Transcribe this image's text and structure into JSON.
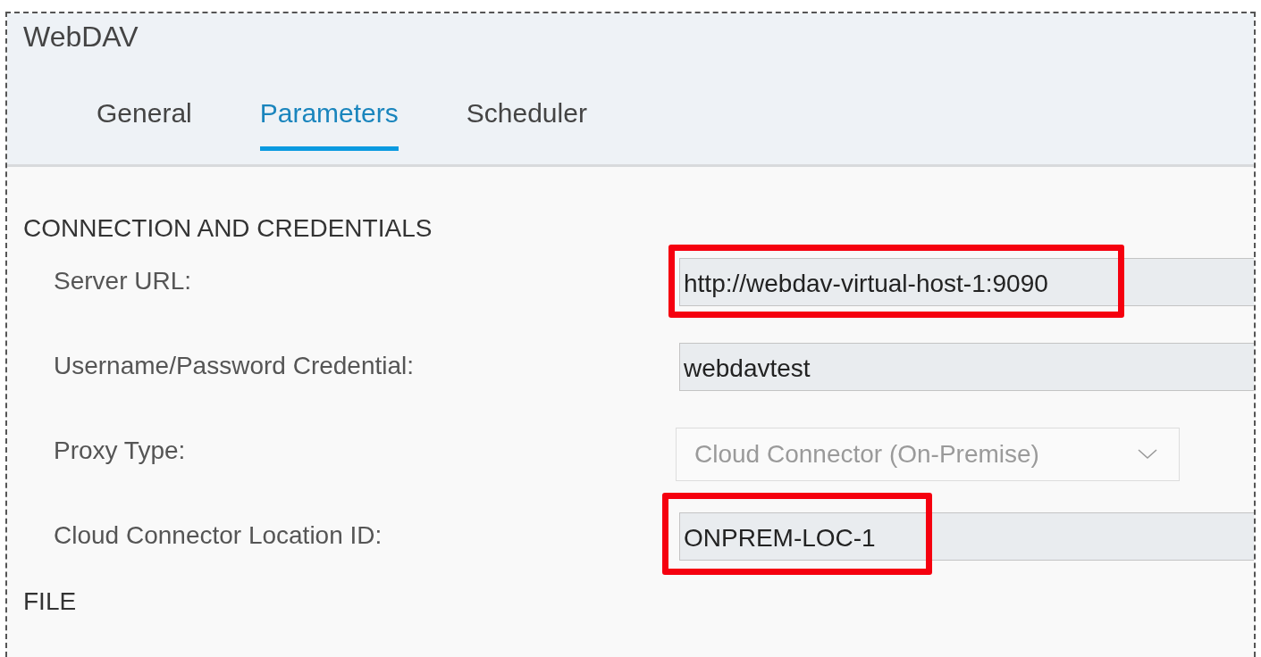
{
  "window": {
    "title": "WebDAV"
  },
  "tabs": [
    {
      "label": "General",
      "selected": false
    },
    {
      "label": "Parameters",
      "selected": true
    },
    {
      "label": "Scheduler",
      "selected": false
    }
  ],
  "sections": [
    {
      "title": "CONNECTION AND CREDENTIALS",
      "fields": [
        {
          "label": "Server URL:",
          "kind": "input",
          "value": "http://webdav-virtual-host-1:9090",
          "disabled": false,
          "highlighted": true
        },
        {
          "label": "Username/Password Credential:",
          "kind": "input",
          "value": "webdavtest",
          "disabled": false,
          "highlighted": false
        },
        {
          "label": "Proxy Type:",
          "kind": "select",
          "value": "Cloud Connector (On-Premise)",
          "disabled": true,
          "highlighted": false
        },
        {
          "label": "Cloud Connector Location ID:",
          "kind": "input",
          "value": "ONPREM-LOC-1",
          "disabled": false,
          "highlighted": true
        }
      ]
    },
    {
      "title": "FILE"
    }
  ]
}
